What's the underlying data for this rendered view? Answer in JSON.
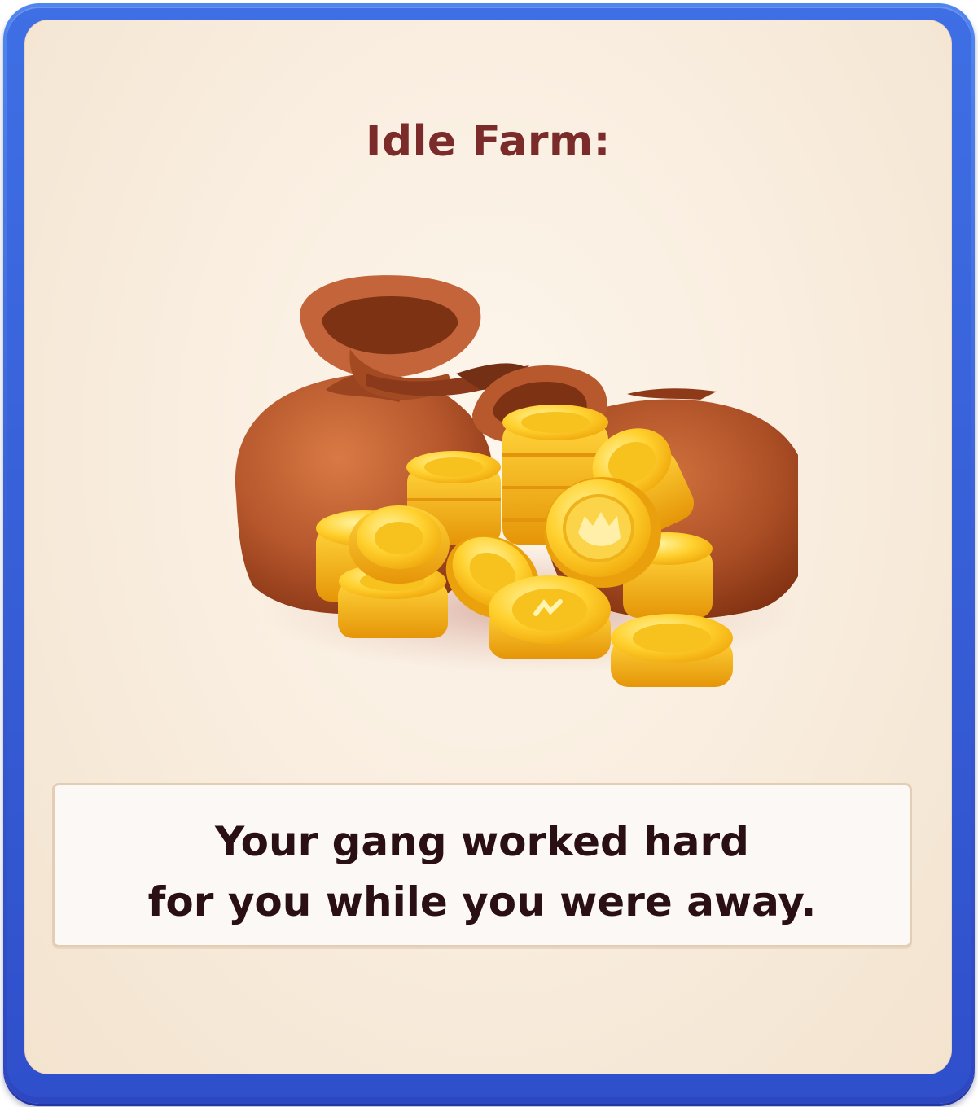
{
  "dialog": {
    "title": "Idle Farm:",
    "message_line1": "Your gang worked hard",
    "message_line2": "for you while you were away."
  },
  "art": {
    "icon": "coin-bags-with-gold-coins-icon"
  },
  "colors": {
    "frame_blue": "#3b62d8",
    "panel_cream": "#f8ecdd",
    "title_maroon": "#7a2b2a",
    "text_dark": "#2a0f14",
    "bag_brown": "#b5562c",
    "coin_gold": "#f3b514"
  }
}
